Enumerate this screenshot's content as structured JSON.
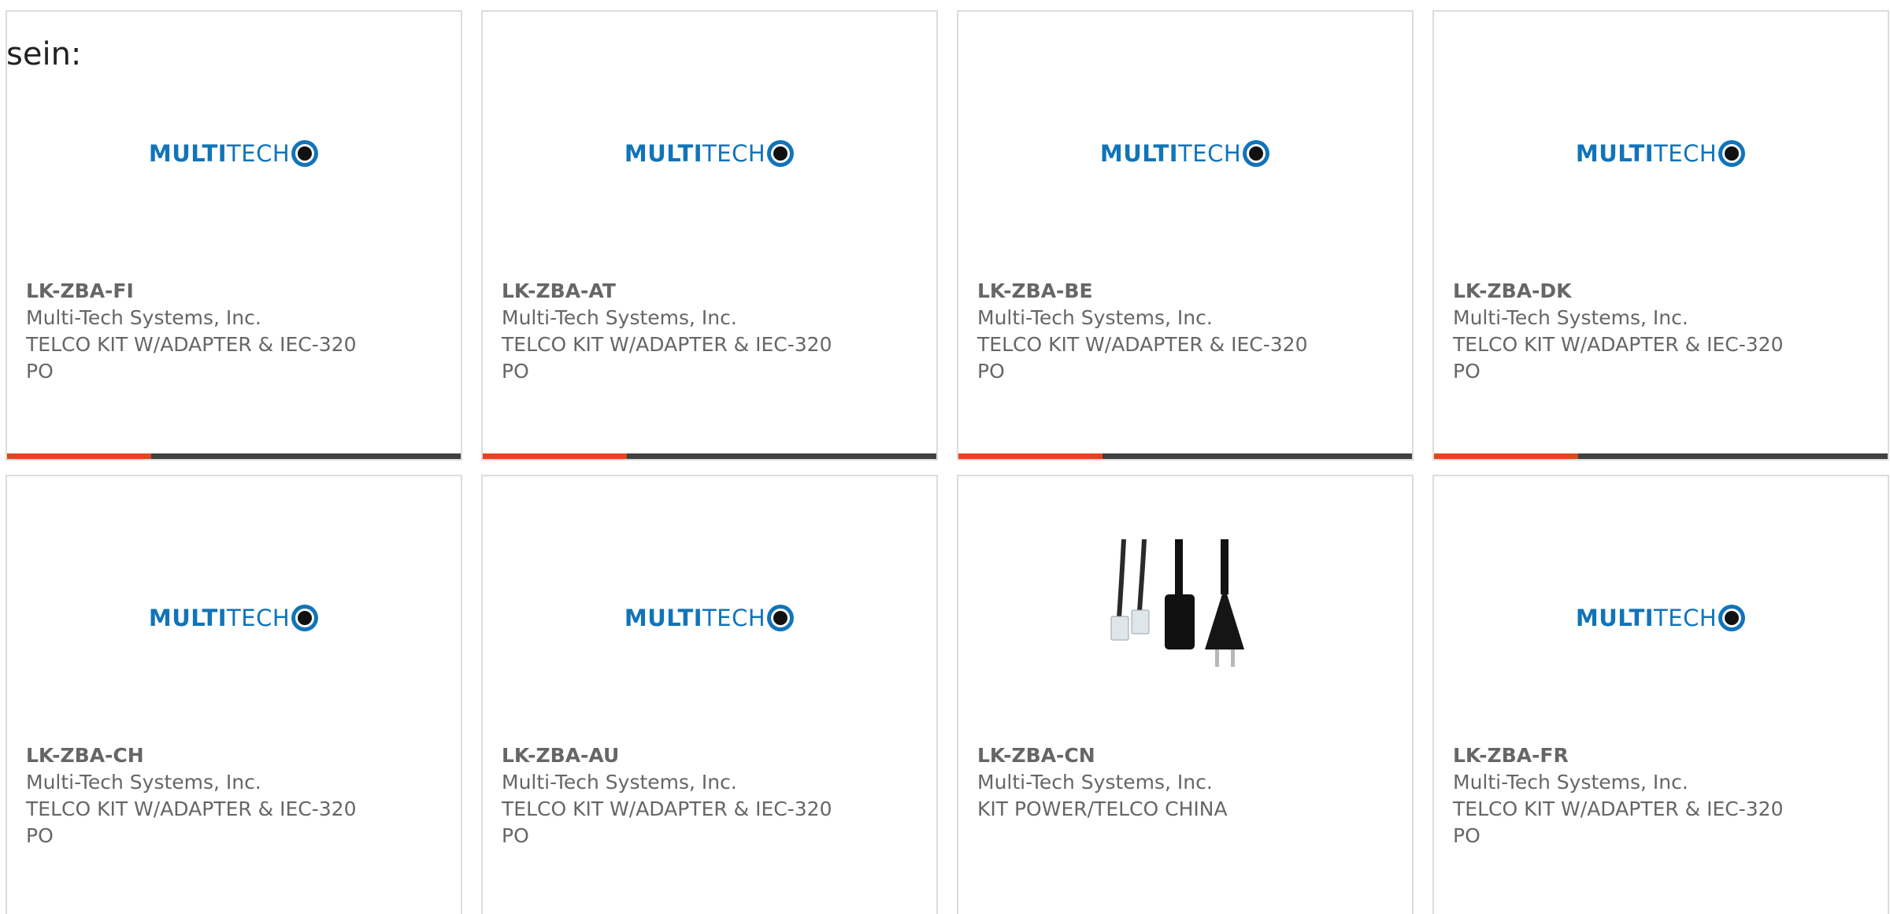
{
  "intro": {
    "text": "sein:"
  },
  "colors": {
    "brand_blue": "#1174b9",
    "accent_orange": "#e3461b",
    "bar_dark": "#404040",
    "text_gray": "#666666"
  },
  "products": [
    {
      "part_number": "LK-ZBA-FI",
      "manufacturer": "Multi-Tech Systems, Inc.",
      "description": "TELCO KIT W/ADAPTER & IEC-320 PO",
      "image": "multitech-logo",
      "logo_multi": "MULTI",
      "logo_tech": "TECH"
    },
    {
      "part_number": "LK-ZBA-AT",
      "manufacturer": "Multi-Tech Systems, Inc.",
      "description": "TELCO KIT W/ADAPTER & IEC-320 PO",
      "image": "multitech-logo",
      "logo_multi": "MULTI",
      "logo_tech": "TECH"
    },
    {
      "part_number": "LK-ZBA-BE",
      "manufacturer": "Multi-Tech Systems, Inc.",
      "description": "TELCO KIT W/ADAPTER & IEC-320 PO",
      "image": "multitech-logo",
      "logo_multi": "MULTI",
      "logo_tech": "TECH"
    },
    {
      "part_number": "LK-ZBA-DK",
      "manufacturer": "Multi-Tech Systems, Inc.",
      "description": "TELCO KIT W/ADAPTER & IEC-320 PO",
      "image": "multitech-logo",
      "logo_multi": "MULTI",
      "logo_tech": "TECH"
    },
    {
      "part_number": "LK-ZBA-CH",
      "manufacturer": "Multi-Tech Systems, Inc.",
      "description": "TELCO KIT W/ADAPTER & IEC-320 PO",
      "image": "multitech-logo",
      "logo_multi": "MULTI",
      "logo_tech": "TECH"
    },
    {
      "part_number": "LK-ZBA-AU",
      "manufacturer": "Multi-Tech Systems, Inc.",
      "description": "TELCO KIT W/ADAPTER & IEC-320 PO",
      "image": "multitech-logo",
      "logo_multi": "MULTI",
      "logo_tech": "TECH"
    },
    {
      "part_number": "LK-ZBA-CN",
      "manufacturer": "Multi-Tech Systems, Inc.",
      "description": "KIT POWER/TELCO CHINA",
      "image": "power-telco-cable-photo"
    },
    {
      "part_number": "LK-ZBA-FR",
      "manufacturer": "Multi-Tech Systems, Inc.",
      "description": "TELCO KIT W/ADAPTER & IEC-320 PO",
      "image": "multitech-logo",
      "logo_multi": "MULTI",
      "logo_tech": "TECH"
    }
  ]
}
